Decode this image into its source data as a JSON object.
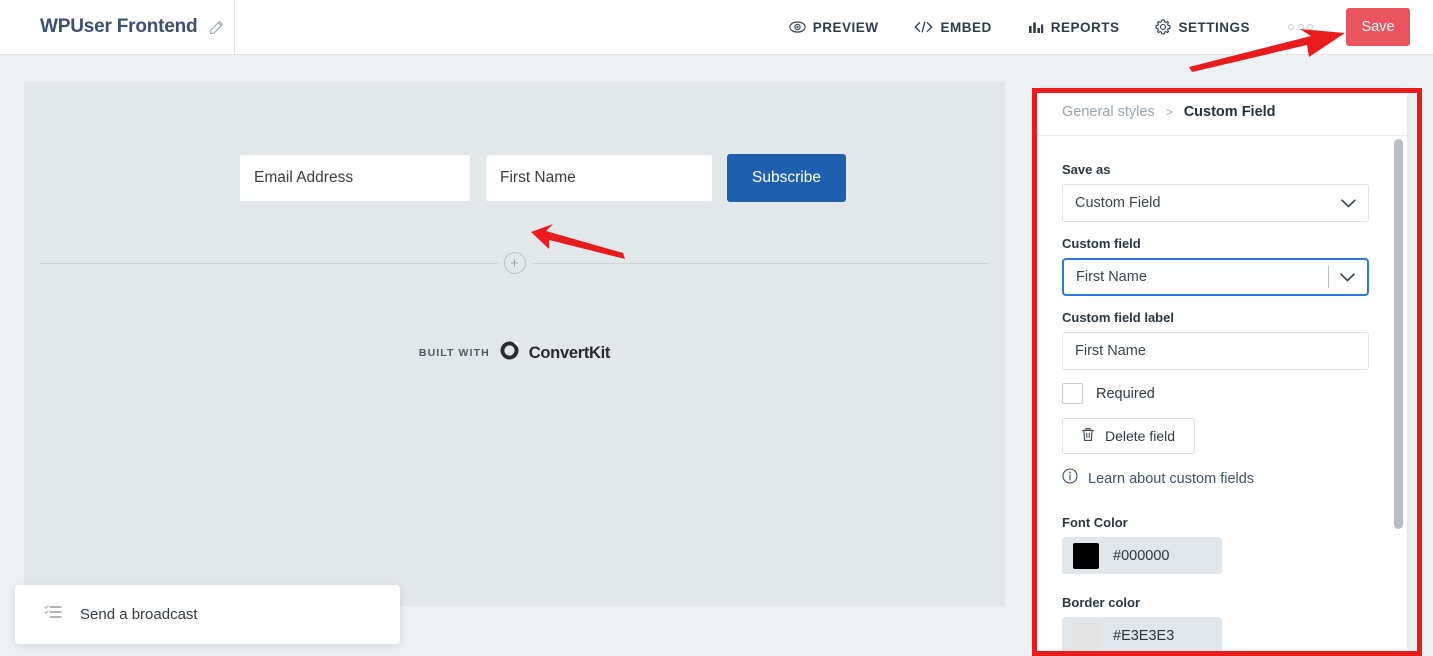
{
  "header": {
    "form_title": "WPUser Frontend",
    "edit_icon": "pencil-icon",
    "nav": [
      {
        "label": "PREVIEW",
        "icon": "eye-icon"
      },
      {
        "label": "EMBED",
        "icon": "code-icon"
      },
      {
        "label": "REPORTS",
        "icon": "bar-chart-icon"
      },
      {
        "label": "SETTINGS",
        "icon": "gear-icon"
      }
    ],
    "overflow_icon": "three-dots-icon",
    "save_label": "Save",
    "save_color": "#e9545f"
  },
  "canvas": {
    "form": {
      "email_placeholder": "Email Address",
      "name_placeholder": "First Name",
      "subscribe_label": "Subscribe",
      "subscribe_color": "#1f60ae",
      "add_field_icon": "plus-icon",
      "built_with_label": "BUILT WITH",
      "brand_name": "ConvertKit",
      "brand_icon": "convertkit-logo-icon"
    },
    "background": "#eef1f4",
    "form_background": "#e2e7ea"
  },
  "toast": {
    "label": "Send a broadcast",
    "icon": "checklist-icon"
  },
  "panel": {
    "breadcrumb": {
      "parent": "General styles",
      "separator": ">",
      "current": "Custom Field"
    },
    "save_as": {
      "label": "Save as",
      "value": "Custom Field",
      "chevron_icon": "chevron-down-icon"
    },
    "custom_field": {
      "label": "Custom field",
      "value": "First Name",
      "chevron_icon": "chevron-down-icon",
      "focus_color": "#2b7ae4"
    },
    "custom_field_label": {
      "label": "Custom field label",
      "value": "First Name"
    },
    "required": {
      "label": "Required",
      "checked": false
    },
    "delete_field": {
      "label": "Delete field",
      "icon": "trash-icon"
    },
    "learn_link": {
      "label": "Learn about custom fields",
      "icon": "info-icon"
    },
    "font_color": {
      "label": "Font Color",
      "value": "#000000",
      "swatch": "#000000"
    },
    "border_color": {
      "label": "Border color",
      "value": "#E3E3E3",
      "swatch": "#E3E3E3"
    },
    "scrollbar": "vertical-scrollbar"
  },
  "annotations": {
    "highlight_color": "#e81c1c",
    "arrow_color": "#e81c1c",
    "arrow_save": "arrow-pointing-to-save-button",
    "arrow_add_field": "arrow-pointing-to-add-field-button",
    "box": "highlight-box-around-settings-panel"
  }
}
